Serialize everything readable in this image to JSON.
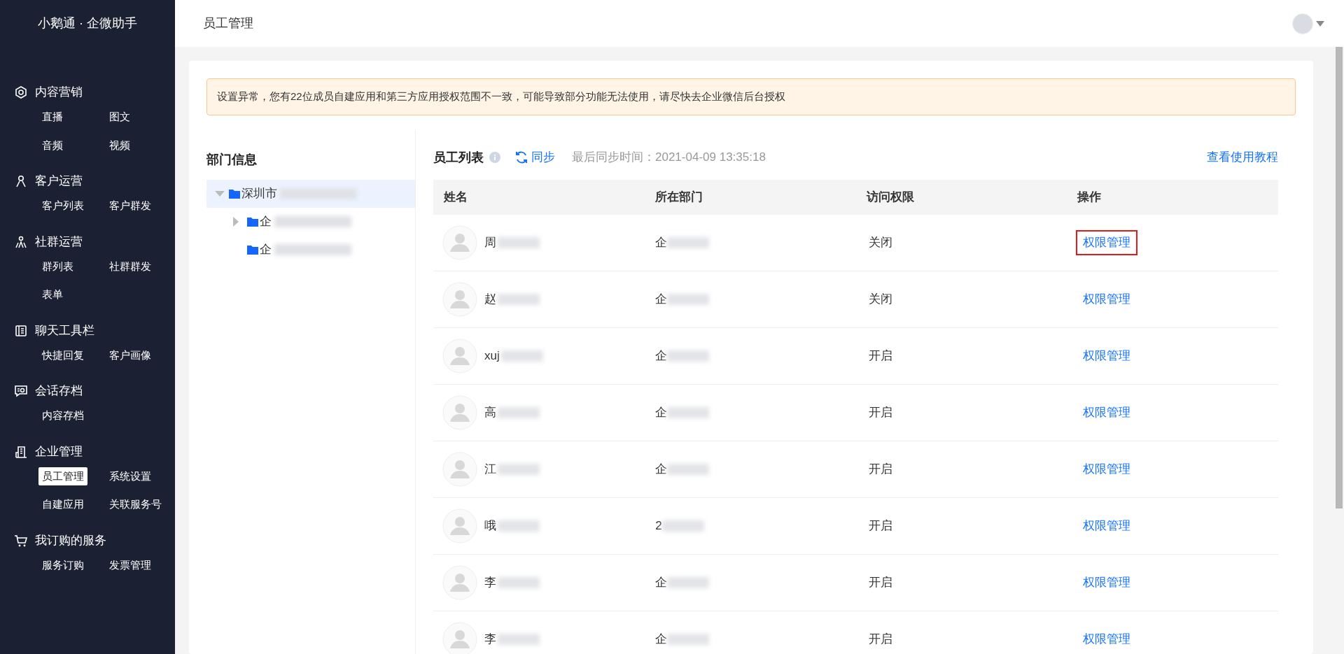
{
  "app_title": "小鹅通 · 企微助手",
  "sidebar": {
    "groups": [
      {
        "label": "内容营销",
        "items": [
          {
            "label": "直播",
            "selected": false
          },
          {
            "label": "图文",
            "selected": false
          },
          {
            "label": "音频",
            "selected": false
          },
          {
            "label": "视频",
            "selected": false
          }
        ]
      },
      {
        "label": "客户运营",
        "items": [
          {
            "label": "客户列表",
            "selected": false
          },
          {
            "label": "客户群发",
            "selected": false
          }
        ]
      },
      {
        "label": "社群运营",
        "items": [
          {
            "label": "群列表",
            "selected": false
          },
          {
            "label": "社群群发",
            "selected": false
          },
          {
            "label": "表单",
            "selected": false
          }
        ]
      },
      {
        "label": "聊天工具栏",
        "items": [
          {
            "label": "快捷回复",
            "selected": false
          },
          {
            "label": "客户画像",
            "selected": false
          }
        ]
      },
      {
        "label": "会话存档",
        "items": [
          {
            "label": "内容存档",
            "selected": false
          }
        ]
      },
      {
        "label": "企业管理",
        "items": [
          {
            "label": "员工管理",
            "selected": true
          },
          {
            "label": "系统设置",
            "selected": false
          },
          {
            "label": "自建应用",
            "selected": false
          },
          {
            "label": "关联服务号",
            "selected": false
          }
        ]
      },
      {
        "label": "我订购的服务",
        "items": [
          {
            "label": "服务订购",
            "selected": false
          },
          {
            "label": "发票管理",
            "selected": false
          }
        ]
      }
    ]
  },
  "header": {
    "title": "员工管理"
  },
  "alert": {
    "text": "设置异常，您有22位成员自建应用和第三方应用授权范围不一致，可能导致部分功能无法使用，请尽快去企业微信后台授权"
  },
  "department_panel": {
    "title": "部门信息",
    "tree": [
      {
        "label": "深圳市",
        "selected": true,
        "expanded": true,
        "children": [
          {
            "label": "企",
            "selected": false,
            "expanded": false
          },
          {
            "label": "企",
            "selected": false
          }
        ]
      }
    ]
  },
  "employee_list": {
    "title": "员工列表",
    "sync_label": "同步",
    "last_sync": "最后同步时间：2021-04-09 13:35:18",
    "tutorial_link": "查看使用教程",
    "columns": [
      "姓名",
      "所在部门",
      "访问权限",
      "操作"
    ],
    "rows": [
      {
        "name": "周",
        "department": "企",
        "access": "关闭",
        "action": "权限管理",
        "highlighted": true
      },
      {
        "name": "赵",
        "department": "企",
        "access": "关闭",
        "action": "权限管理",
        "highlighted": false
      },
      {
        "name": "xuj",
        "department": "企",
        "access": "开启",
        "action": "权限管理",
        "highlighted": false
      },
      {
        "name": "高",
        "department": "企",
        "access": "开启",
        "action": "权限管理",
        "highlighted": false
      },
      {
        "name": "江",
        "department": "企",
        "access": "开启",
        "action": "权限管理",
        "highlighted": false
      },
      {
        "name": "哦",
        "department": "2",
        "access": "开启",
        "action": "权限管理",
        "highlighted": false
      },
      {
        "name": "李",
        "department": "企",
        "access": "开启",
        "action": "权限管理",
        "highlighted": false
      },
      {
        "name": "李",
        "department": "企",
        "access": "开启",
        "action": "权限管理",
        "highlighted": false
      }
    ]
  }
}
